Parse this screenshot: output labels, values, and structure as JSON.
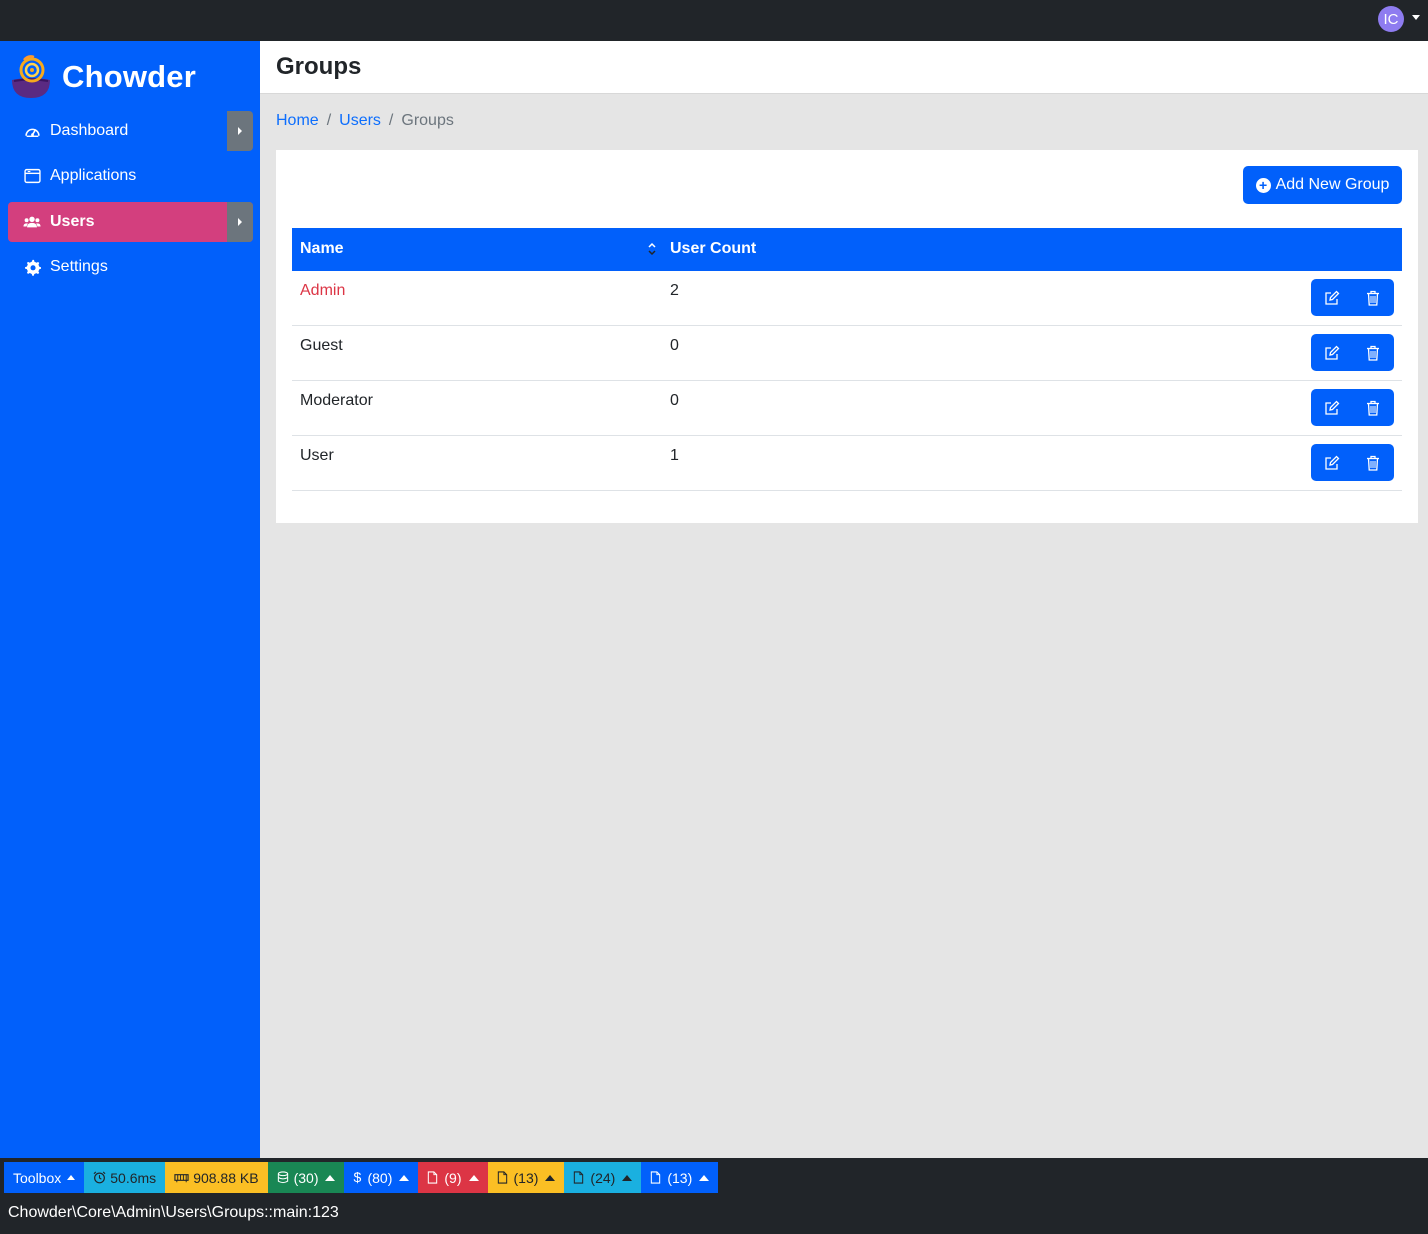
{
  "topbar": {
    "avatar_initials": "IC"
  },
  "brand": {
    "name": "Chowder"
  },
  "sidebar": {
    "items": [
      {
        "label": "Dashboard",
        "icon": "gauge-icon",
        "active": false,
        "has_toggle": true
      },
      {
        "label": "Applications",
        "icon": "window-icon",
        "active": false,
        "has_toggle": false
      },
      {
        "label": "Users",
        "icon": "users-icon",
        "active": true,
        "has_toggle": true
      },
      {
        "label": "Settings",
        "icon": "gear-icon",
        "active": false,
        "has_toggle": false
      }
    ]
  },
  "header": {
    "title": "Groups"
  },
  "breadcrumb": {
    "home": "Home",
    "users": "Users",
    "current": "Groups",
    "separator": "/"
  },
  "toolbar": {
    "add_label": "Add New Group"
  },
  "table": {
    "columns": [
      "Name",
      "User Count"
    ],
    "rows": [
      {
        "name": "Admin",
        "count": "2"
      },
      {
        "name": "Guest",
        "count": "0"
      },
      {
        "name": "Moderator",
        "count": "0"
      },
      {
        "name": "User",
        "count": "1"
      }
    ]
  },
  "debug_toolbar": {
    "label": "Toolbox",
    "time": "50.6ms",
    "memory": "908.88 KB",
    "database": "(30)",
    "variables": "(80)",
    "html_files": "(9)",
    "css_files": "(13)",
    "js_files": "(24)",
    "json_files": "(13)",
    "route": "Chowder\\Core\\Admin\\Users\\Groups::main:123"
  },
  "colors": {
    "primary": "#0160fb",
    "active_nav": "#d33f7e",
    "danger_text": "#dc3545",
    "dark": "#212529"
  }
}
